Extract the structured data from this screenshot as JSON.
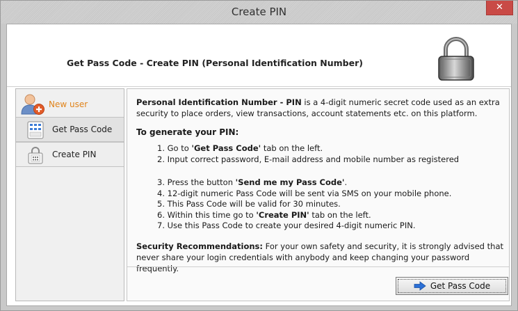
{
  "window": {
    "title": "Create PIN",
    "close_glyph": "✕"
  },
  "header": {
    "heading": "Get Pass Code - Create PIN (Personal Identification Number)",
    "icon": "padlock-icon"
  },
  "sidebar": {
    "new_user_label": "New user",
    "items": [
      {
        "label": "Get Pass Code",
        "icon": "keypad-icon"
      },
      {
        "label": "Create PIN",
        "icon": "keypad-lock-icon"
      }
    ]
  },
  "content": {
    "intro_bold": "Personal Identification Number - PIN",
    "intro_rest_1": " is a 4-digit numeric secret code used as an extra",
    "intro_line_2": "security to place orders, view transactions, account statements etc. on this platform.",
    "generate_title": "To generate your PIN:",
    "step1_pre": "1. Go to ",
    "step1_bold": "'Get Pass Code'",
    "step1_post": " tab on the left.",
    "step2": "2. Input correct password, E-mail address and mobile number as registered",
    "step3_pre": "3. Press the button ",
    "step3_bold": "'Send me my Pass Code'",
    "step3_post": ".",
    "step4": "4. 12-digit numeric Pass Code will be sent via SMS on your mobile phone.",
    "step5": "5. This Pass Code will be valid for 30 minutes.",
    "step6_pre": "6. Within this time go to ",
    "step6_bold": "'Create PIN'",
    "step6_post": " tab on the left.",
    "step7": "7. Use this Pass Code to create your desired 4-digit numeric PIN.",
    "security_bold": "Security Recommendations:",
    "security_rest_1": " For your own safety and security, it is strongly advised that",
    "security_line_2": "never share your login credentials with anybody and keep changing your password frequently."
  },
  "footer": {
    "button_label": "Get Pass Code",
    "button_icon": "arrow-right-icon"
  },
  "colors": {
    "accent_orange": "#e0831a",
    "close_red": "#c94a46",
    "arrow_blue": "#2a6fd6"
  }
}
